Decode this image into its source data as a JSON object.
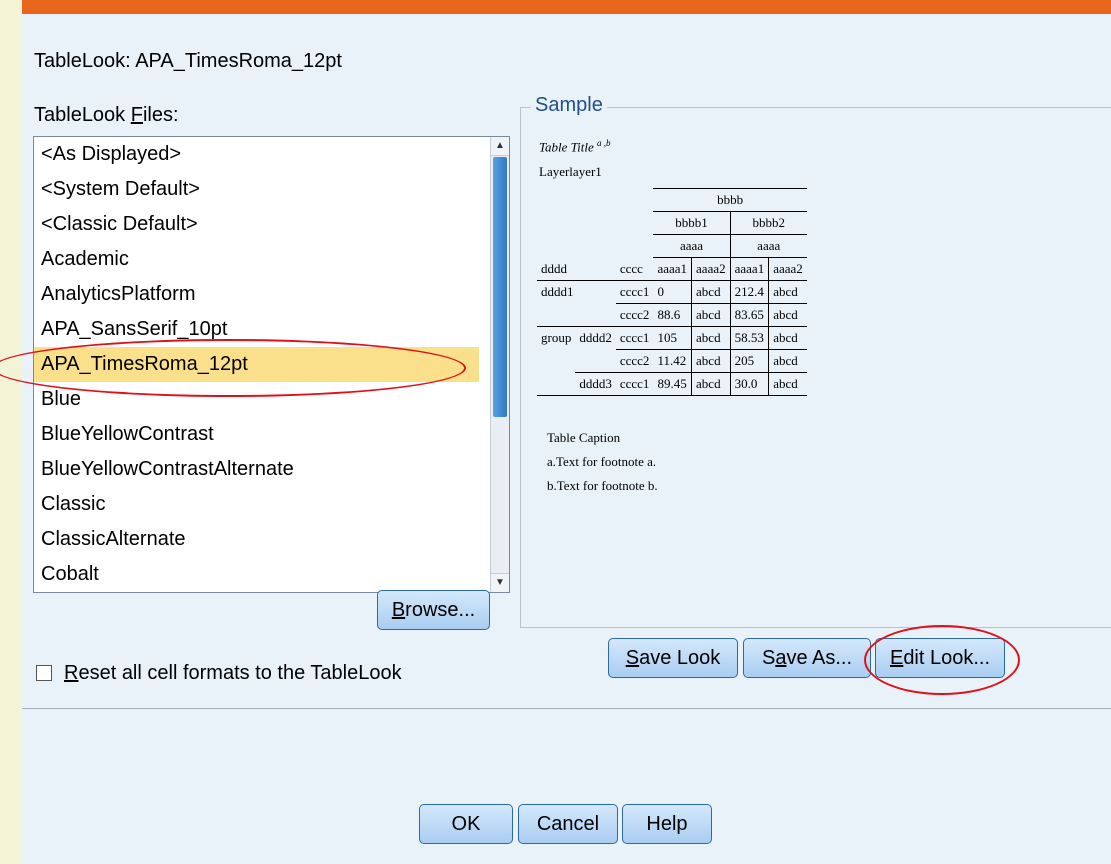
{
  "dialog": {
    "tablelook_label": "TableLook:",
    "tablelook_value": "APA_TimesRoma_12pt",
    "files_label_pre": "TableLook ",
    "files_label_mnemonic": "F",
    "files_label_post": "iles:",
    "files": [
      "<As Displayed>",
      "<System Default>",
      "<Classic Default>",
      "Academic",
      "AnalyticsPlatform",
      "APA_SansSerif_10pt",
      "APA_TimesRoma_12pt",
      "Blue",
      "BlueYellowContrast",
      "BlueYellowContrastAlternate",
      "Classic",
      "ClassicAlternate",
      "Cobalt"
    ],
    "selected_file": "APA_TimesRoma_12pt",
    "browse_label": "Browse...",
    "reset_checkbox_label": "Reset all cell formats to the TableLook",
    "reset_checked": false
  },
  "sample": {
    "legend": "Sample",
    "title": "Table Title",
    "title_sup": "a ,b",
    "layer": "Layerlayer1",
    "table": {
      "h_bbbb": "bbbb",
      "h_bbbb1": "bbbb1",
      "h_bbbb2": "bbbb2",
      "h_aaaa": "aaaa",
      "h_dddd": "dddd",
      "h_cccc": "cccc",
      "h_aaaa1": "aaaa1",
      "h_aaaa2": "aaaa2",
      "rows": [
        {
          "group": "",
          "d": "dddd1",
          "c": "cccc1",
          "v1": "0",
          "v2": "abcd",
          "v3": "212.4",
          "v4": "abcd"
        },
        {
          "group": "",
          "d": "",
          "c": "cccc2",
          "v1": "88.6",
          "v2": "abcd",
          "v3": "83.65",
          "v4": "abcd"
        },
        {
          "group": "group",
          "d": "dddd2",
          "c": "cccc1",
          "v1": "105",
          "v2": "abcd",
          "v3": "58.53",
          "v4": "abcd"
        },
        {
          "group": "",
          "d": "",
          "c": "cccc2",
          "v1": "11.42",
          "v2": "abcd",
          "v3": "205",
          "v4": "abcd"
        },
        {
          "group": "",
          "d": "dddd3",
          "c": "cccc1",
          "v1": "89.45",
          "v2": "abcd",
          "v3": "30.0",
          "v4": "abcd"
        }
      ]
    },
    "caption": "Table Caption",
    "footnote_a": "a.Text for footnote a.",
    "footnote_b": "b.Text for footnote b."
  },
  "buttons": {
    "save_look_mn": "S",
    "save_look_rest": "ave Look",
    "save_as_pre": "S",
    "save_as_mn": "a",
    "save_as_rest": "ve As...",
    "edit_look_mn": "E",
    "edit_look_rest": "dit Look...",
    "ok": "OK",
    "cancel": "Cancel",
    "help": "Help"
  },
  "colors": {
    "accent_bar": "#e8651c",
    "selection": "#fbe08c",
    "annotation": "#e0101a",
    "button_border": "#2c6aa6"
  }
}
